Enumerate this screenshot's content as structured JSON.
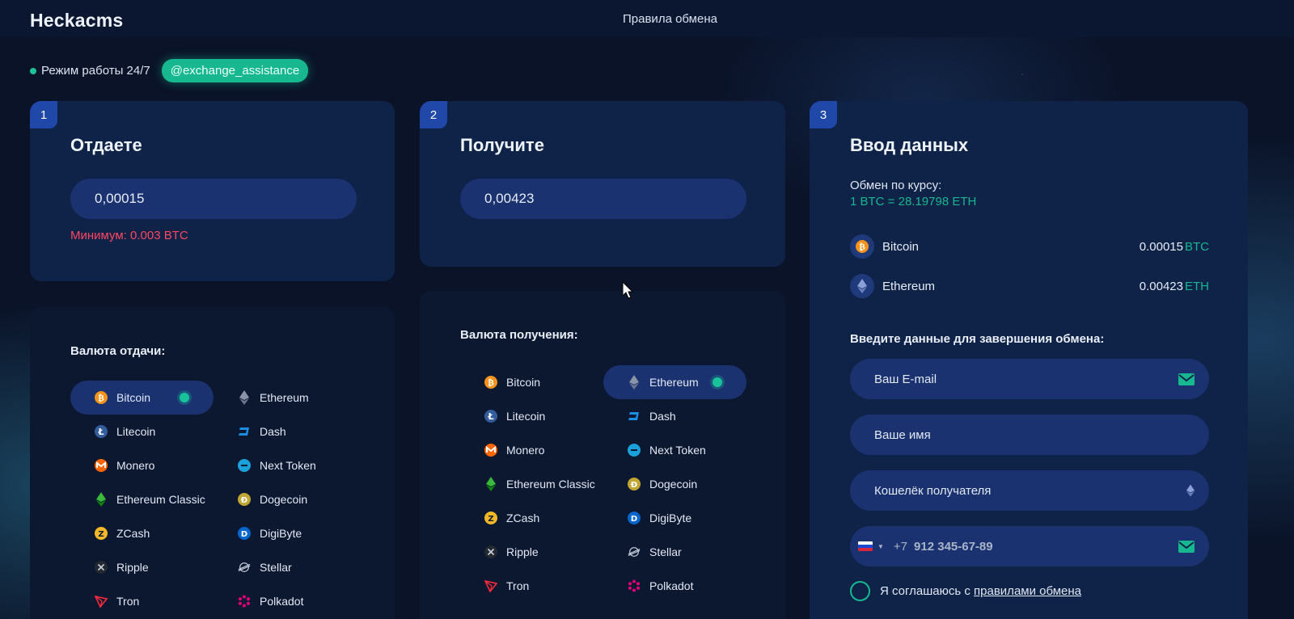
{
  "header": {
    "brand": "Heckacms",
    "nav_link": "Правила обмена"
  },
  "status": {
    "text": "Режим работы 24/7",
    "telegram": "@exchange_assistance"
  },
  "give": {
    "number": "1",
    "title": "Отдаете",
    "amount": "0,00015",
    "minimum": "Минимум: 0.003 BTC",
    "list_title": "Валюта отдачи:",
    "selected": "Bitcoin"
  },
  "receive": {
    "number": "2",
    "title": "Получите",
    "amount": "0,00423",
    "list_title": "Валюта получения:",
    "selected": "Ethereum"
  },
  "coins": [
    {
      "name": "Bitcoin",
      "icon": "bitcoin-icon"
    },
    {
      "name": "Ethereum",
      "icon": "ethereum-icon"
    },
    {
      "name": "Litecoin",
      "icon": "litecoin-icon"
    },
    {
      "name": "Dash",
      "icon": "dash-icon"
    },
    {
      "name": "Monero",
      "icon": "monero-icon"
    },
    {
      "name": "Next Token",
      "icon": "next-token-icon"
    },
    {
      "name": "Ethereum Classic",
      "icon": "ethereum-classic-icon"
    },
    {
      "name": "Dogecoin",
      "icon": "dogecoin-icon"
    },
    {
      "name": "ZCash",
      "icon": "zcash-icon"
    },
    {
      "name": "DigiByte",
      "icon": "digibyte-icon"
    },
    {
      "name": "Ripple",
      "icon": "ripple-icon"
    },
    {
      "name": "Stellar",
      "icon": "stellar-icon"
    },
    {
      "name": "Tron",
      "icon": "tron-icon"
    },
    {
      "name": "Polkadot",
      "icon": "polkadot-icon"
    }
  ],
  "details": {
    "number": "3",
    "title": "Ввод данных",
    "rate_label": "Обмен по курсу:",
    "rate_value": "1 BTC = 28.19798 ETH",
    "summary": [
      {
        "name": "Bitcoin",
        "amount": "0.00015",
        "currency": "BTC"
      },
      {
        "name": "Ethereum",
        "amount": "0.00423",
        "currency": "ETH"
      }
    ],
    "form_title": "Введите данные для завершения обмена:",
    "email_placeholder": "Ваш E-mail",
    "name_placeholder": "Ваше имя",
    "wallet_placeholder": "Кошелёк получателя",
    "phone_prefix": "+7",
    "phone_placeholder": "912 345-67-89",
    "agree_text": "Я соглашаюсь с ",
    "agree_link": "правилами обмена"
  },
  "colors": {
    "accent": "#17b890",
    "error": "#ff4762",
    "card": "#0f2247",
    "field": "#1b3270",
    "badge": "#1f48a8"
  }
}
